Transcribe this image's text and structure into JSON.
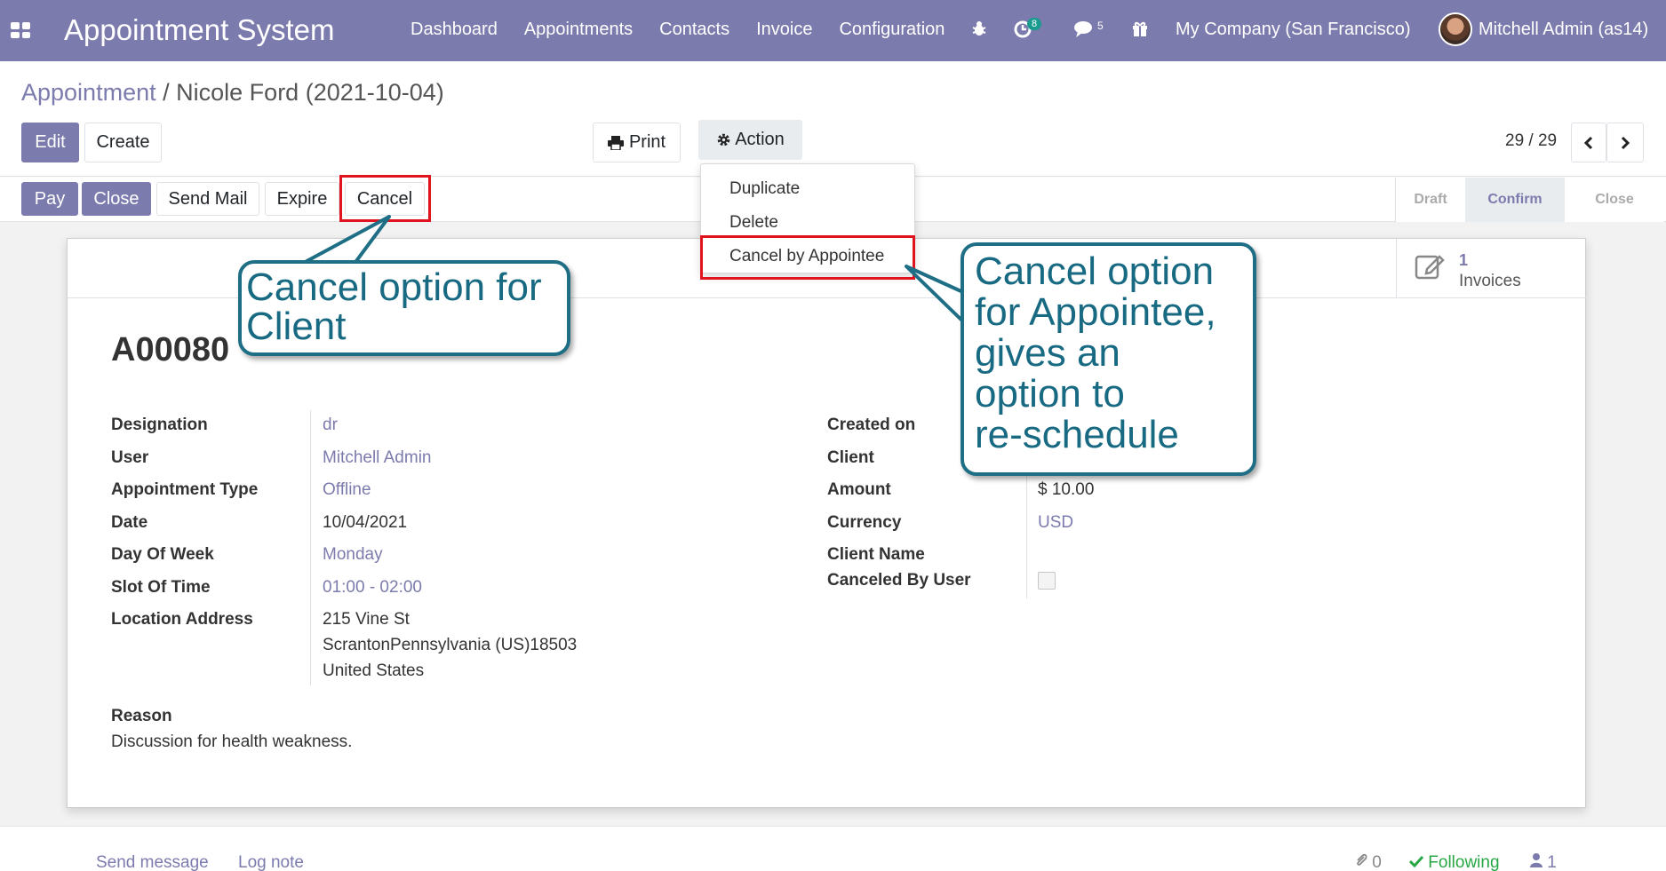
{
  "navbar": {
    "brand": "Appointment System",
    "menu": [
      "Dashboard",
      "Appointments",
      "Contacts",
      "Invoice",
      "Configuration"
    ],
    "activity_badge": "8",
    "messages_count": "5",
    "company": "My Company (San Francisco)",
    "user": "Mitchell Admin (as14)",
    "icons": [
      "apps-icon",
      "bug-icon",
      "clock-icon",
      "chat-icon",
      "gift-icon"
    ]
  },
  "breadcrumb": {
    "parent": "Appointment",
    "separator": "/",
    "current": "Nicole Ford (2021-10-04)"
  },
  "toolbar": {
    "edit": "Edit",
    "create": "Create",
    "print": "Print",
    "action": "Action",
    "pager": "29 / 29"
  },
  "action_menu": [
    "Duplicate",
    "Delete",
    "Cancel by Appointee"
  ],
  "statusbar": {
    "buttons": [
      "Pay",
      "Close",
      "Send Mail",
      "Expire",
      "Cancel"
    ],
    "stages": [
      "Draft",
      "Confirm",
      "Close"
    ],
    "active_stage": "Confirm"
  },
  "smart_button": {
    "count": "1",
    "label": "Invoices"
  },
  "record": {
    "name": "A00080",
    "left_fields": [
      {
        "label": "Designation",
        "value": "dr"
      },
      {
        "label": "User",
        "value": "Mitchell Admin"
      },
      {
        "label": "Appointment Type",
        "value": "Offline"
      },
      {
        "label": "Date",
        "value": "10/04/2021"
      },
      {
        "label": "Day Of Week",
        "value": "Monday"
      },
      {
        "label": "Slot Of Time",
        "value": "01:00 - 02:00"
      },
      {
        "label": "Location Address",
        "value": "215 Vine St"
      }
    ],
    "address_line2": "ScrantonPennsylvania (US)18503",
    "address_line3": "United States",
    "right_fields": [
      {
        "label": "Created on",
        "value": ""
      },
      {
        "label": "Client",
        "value": ""
      },
      {
        "label": "Amount",
        "value": "$ 10.00"
      },
      {
        "label": "Currency",
        "value": "USD"
      },
      {
        "label": "Client Name",
        "value": ""
      },
      {
        "label": "Canceled By User",
        "value": ""
      }
    ],
    "reason_label": "Reason",
    "reason_value": "Discussion for health weakness."
  },
  "chatter": {
    "send_message": "Send message",
    "log_note": "Log note",
    "attachments": "0",
    "following": "Following",
    "followers": "1"
  },
  "annotations": {
    "client_callout_line1": "Cancel option for",
    "client_callout_line2": "Client",
    "appointee_callout_lines": [
      "Cancel option",
      "for Appointee,",
      "gives an",
      "option to",
      "re-schedule"
    ],
    "accent_color": "#1e6e85",
    "highlight_color": "#e0141e"
  }
}
